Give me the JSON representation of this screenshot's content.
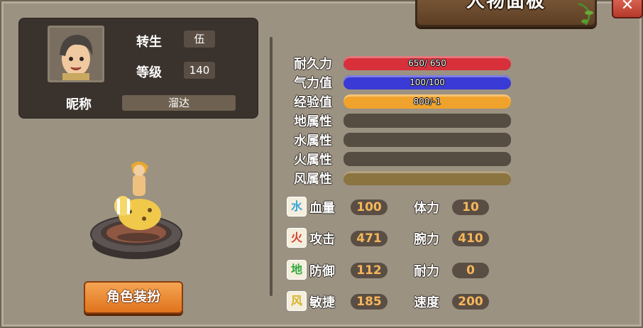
{
  "title": "人物面板",
  "close_glyph": "✕",
  "profile": {
    "rebirth_label": "转生",
    "rebirth_value": "伍",
    "level_label": "等级",
    "level_value": "140",
    "nickname_label": "昵称",
    "nickname_value": "溜达"
  },
  "dress_button": "角色装扮",
  "bars": [
    {
      "label": "耐久力",
      "text": "650/ 650",
      "fraction": 1.0,
      "color": "#d7303a"
    },
    {
      "label": "气力值",
      "text": "100/100",
      "fraction": 1.0,
      "color": "#3a3ad6"
    },
    {
      "label": "经验值",
      "text": "800/-1",
      "fraction": 1.0,
      "color": "#f0a32c"
    },
    {
      "label": "地属性",
      "text": "",
      "fraction": 0,
      "color": "#8a7a52"
    },
    {
      "label": "水属性",
      "text": "",
      "fraction": 0,
      "color": "#8a7a52"
    },
    {
      "label": "火属性",
      "text": "",
      "fraction": 0,
      "color": "#8a7a52"
    },
    {
      "label": "风属性",
      "text": "",
      "fraction": 1.0,
      "color": "#8c7440"
    }
  ],
  "stats": {
    "hp": {
      "icon": "水",
      "icon_color": "#3aa4d8",
      "label": "血量",
      "value": "100"
    },
    "stamina": {
      "label": "体力",
      "value": "10"
    },
    "attack": {
      "icon": "火",
      "icon_color": "#d8402a",
      "label": "攻击",
      "value": "471"
    },
    "strength": {
      "label": "腕力",
      "value": "410"
    },
    "defense": {
      "icon": "地",
      "icon_color": "#2fa83f",
      "label": "防御",
      "value": "112"
    },
    "endurance": {
      "label": "耐力",
      "value": "0"
    },
    "agility": {
      "icon": "风",
      "icon_color": "#d8b22a",
      "label": "敏捷",
      "value": "185"
    },
    "speed": {
      "label": "速度",
      "value": "200"
    }
  }
}
